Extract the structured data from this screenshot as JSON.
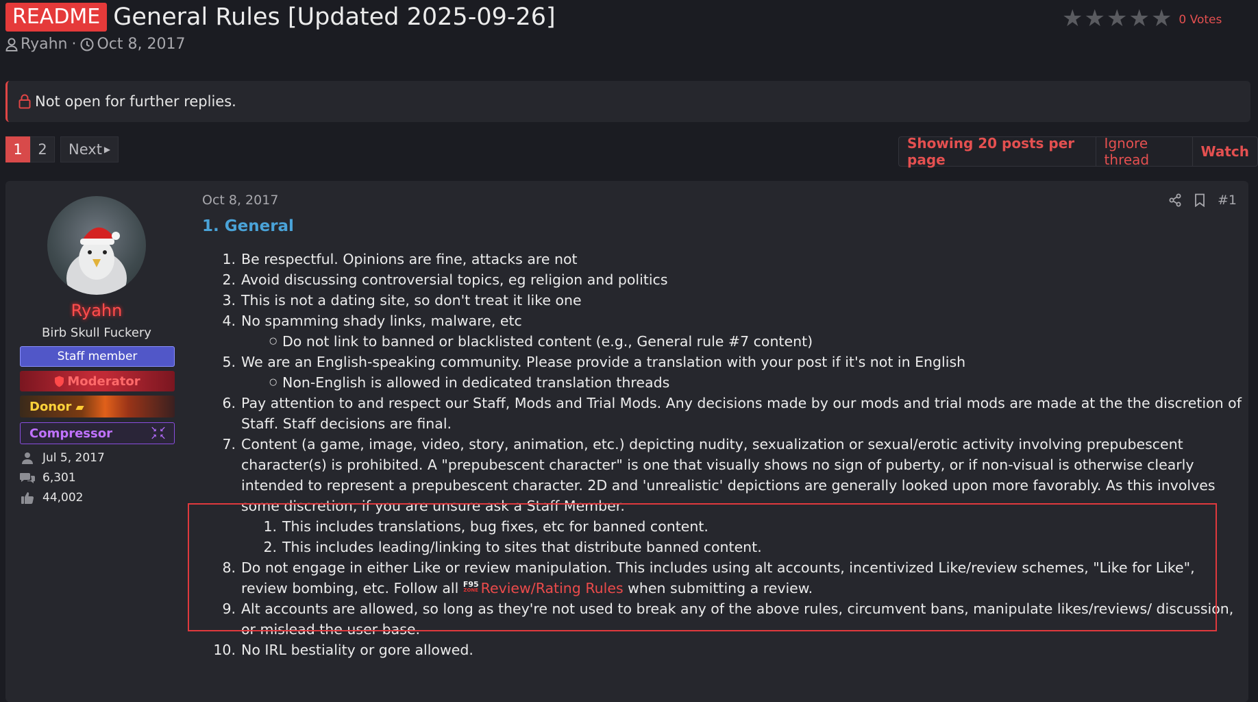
{
  "header": {
    "prefix": "README",
    "title": "General Rules [Updated 2025-09-26]",
    "author": "Ryahn",
    "separator": "·",
    "date": "Oct 8, 2017",
    "rating": {
      "stars": 5,
      "filled": 0,
      "votes_label": "0 Votes"
    }
  },
  "notice": {
    "text": "Not open for further replies."
  },
  "pagination": {
    "pages": [
      "1",
      "2"
    ],
    "current": "1",
    "next_label": "Next"
  },
  "thread_actions": {
    "posts_per_page": "Showing 20 posts per page",
    "ignore": "Ignore thread",
    "watch": "Watch"
  },
  "post": {
    "user": {
      "name": "Ryahn",
      "title": "Birb Skull Fuckery",
      "banners": {
        "staff": "Staff member",
        "moderator": "Moderator",
        "donor": "Donor",
        "compressor": "Compressor"
      },
      "stats": {
        "joined": "Jul 5, 2017",
        "messages": "6,301",
        "reactions": "44,002"
      }
    },
    "date": "Oct 8, 2017",
    "post_number": "#1",
    "heading": "1. General",
    "rules": {
      "r1": {
        "num": "1.",
        "text": "Be respectful. Opinions are fine, attacks are not"
      },
      "r2": {
        "num": "2.",
        "text": "Avoid discussing controversial topics, eg religion and politics"
      },
      "r3": {
        "num": "3.",
        "text": "This is not a dating site, so don't treat it like one"
      },
      "r4": {
        "num": "4.",
        "text": "No spamming shady links, malware, etc"
      },
      "r4a": "Do not link to banned or blacklisted content (e.g., General rule #7 content)",
      "r5": {
        "num": "5.",
        "text": "We are an English-speaking community. Please provide a translation with your post if it's not in English"
      },
      "r5a": "Non-English is allowed in dedicated translation threads",
      "r6": {
        "num": "6.",
        "text": "Pay attention to and respect our Staff, Mods and Trial Mods. Any decisions made by our mods and trial mods are made at the the discretion of Staff. Staff decisions are final."
      },
      "r7": {
        "num": "7.",
        "text": "Content (a game, image, video, story, animation, etc.) depicting nudity, sexualization or sexual/erotic activity involving prepubescent character(s) is prohibited. A \"prepubescent character\" is one that visually shows no sign of puberty, or if non-visual is otherwise clearly intended to represent a prepubescent character. 2D and 'unrealistic' depictions are generally looked upon more favorably. As this involves some discretion, if you are unsure ask a Staff Member."
      },
      "r7a": {
        "num": "1.",
        "text": "This includes translations, bug fixes, etc for banned content."
      },
      "r7b": {
        "num": "2.",
        "text": "This includes leading/linking to sites that distribute banned content."
      },
      "r8": {
        "num": "8.",
        "text_before": "Do not engage in either Like or review manipulation. This includes using alt accounts, incentivized Like/review schemes, \"Like for Like\", review bombing, etc. Follow all ",
        "logo": "F95",
        "logo_sub": "ZONE",
        "link": "Review/Rating Rules",
        "text_after": " when submitting a review."
      },
      "r9": {
        "num": "9.",
        "text": "Alt accounts are allowed, so long as they're not used to break any of the above rules, circumvent bans, manipulate likes/reviews/ discussion, or mislead the user base."
      },
      "r10": {
        "num": "10.",
        "text": "No IRL bestiality or gore allowed."
      }
    }
  },
  "colors": {
    "accent": "#e45050",
    "heading_blue": "#4aa3d8",
    "staff_banner": "#5157c8",
    "moderator_banner": "#c02a36",
    "compressor_text": "#c072ff",
    "highlight_box": "#e0393d"
  },
  "icons": [
    "user-icon",
    "clock-icon",
    "star-icon",
    "lock-icon",
    "share-icon",
    "bookmark-icon",
    "calendar-user-icon",
    "messages-icon",
    "thumbs-up-icon",
    "shield-icon",
    "compress-arrows-icon"
  ]
}
